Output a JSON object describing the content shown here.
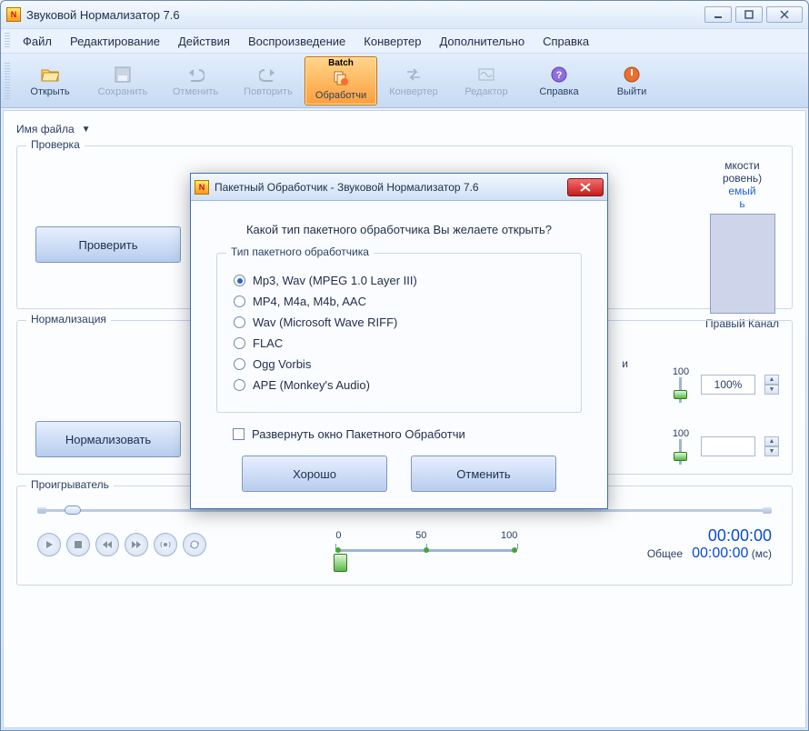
{
  "window": {
    "title": "Звуковой Нормализатор 7.6"
  },
  "menu": {
    "file": "Файл",
    "edit": "Редактирование",
    "actions": "Действия",
    "playback": "Воспроизведение",
    "converter": "Конвертер",
    "extra": "Дополнительно",
    "help": "Справка"
  },
  "toolbar": {
    "open": "Открыть",
    "save": "Сохранить",
    "undo": "Отменить",
    "redo": "Повторить",
    "batch_top": "Batch",
    "batch": "Обработчи",
    "converter": "Конвертер",
    "editor": "Редактор",
    "help": "Справка",
    "exit": "Выйти"
  },
  "file_header": {
    "label": "Имя файла",
    "arrow": "▼"
  },
  "groups": {
    "check": "Проверка",
    "normalize": "Нормализация",
    "player": "Проигрыватель"
  },
  "buttons": {
    "check": "Проверить",
    "normalize": "Нормализовать"
  },
  "right": {
    "frag1": "мкости",
    "frag2": "ровень)",
    "link1": "емый",
    "link2": "ь",
    "channel_label": "Правый Канал"
  },
  "norm": {
    "frag_top": "и",
    "mark1": "100",
    "value1": "100%",
    "mark2": "100"
  },
  "player": {
    "scale_0": "0",
    "scale_50": "50",
    "scale_100": "100",
    "time_current": "00:00:00",
    "total_label": "Общее",
    "time_total": "00:00:00",
    "time_unit": "(мс)"
  },
  "modal": {
    "title": "Пакетный Обработчик - Звуковой Нормализатор 7.6",
    "question": "Какой тип пакетного обработчика Вы желаете открыть?",
    "group_title": "Тип пакетного обработчика",
    "options": [
      "Mp3, Wav (MPEG 1.0 Layer III)",
      "MP4, M4a, M4b, AAC",
      "Wav (Microsoft Wave RIFF)",
      "FLAC",
      "Ogg Vorbis",
      "APE (Monkey's Audio)"
    ],
    "checkbox": "Развернуть окно Пакетного Обработчи",
    "ok": "Хорошо",
    "cancel": "Отменить"
  }
}
